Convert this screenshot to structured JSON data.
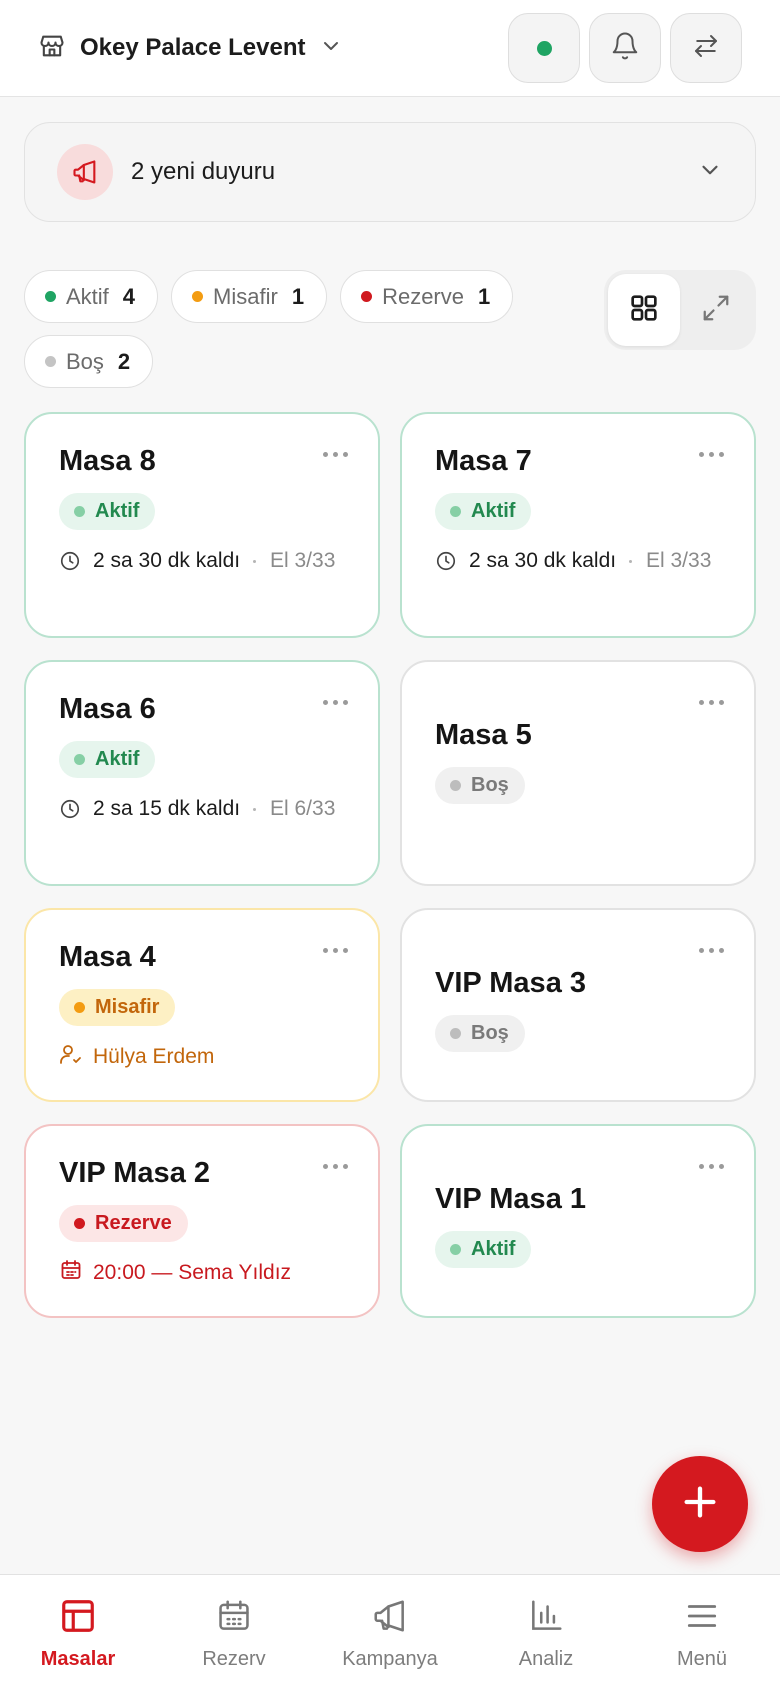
{
  "header": {
    "venue_name": "Okey Palace Levent"
  },
  "announcement": {
    "text": "2 yeni duyuru"
  },
  "filters": [
    {
      "label": "Aktif",
      "count": "4",
      "color": "#1fa463"
    },
    {
      "label": "Misafir",
      "count": "1",
      "color": "#f39c12"
    },
    {
      "label": "Rezerve",
      "count": "1",
      "color": "#d0191f"
    },
    {
      "label": "Boş",
      "count": "2",
      "color": "#c4c4c4"
    }
  ],
  "tables": [
    {
      "name": "Masa 8",
      "status": "Aktif",
      "time_left": "2 sa 30 dk kaldı",
      "hand": "El 3/33"
    },
    {
      "name": "Masa 7",
      "status": "Aktif",
      "time_left": "2 sa 30 dk kaldı",
      "hand": "El 3/33"
    },
    {
      "name": "Masa 6",
      "status": "Aktif",
      "time_left": "2 sa 15 dk kaldı",
      "hand": "El 6/33"
    },
    {
      "name": "Masa 5",
      "status": "Boş"
    },
    {
      "name": "Masa 4",
      "status": "Misafir",
      "guest": "Hülya Erdem"
    },
    {
      "name": "VIP Masa 3",
      "status": "Boş"
    },
    {
      "name": "VIP Masa 2",
      "status": "Rezerve",
      "reservation": "20:00 — Sema Yıldız"
    },
    {
      "name": "VIP Masa 1",
      "status": "Aktif"
    }
  ],
  "bottom_nav": [
    {
      "label": "Masalar",
      "icon": "table-icon",
      "active": true
    },
    {
      "label": "Rezerv",
      "icon": "calendar-icon",
      "active": false
    },
    {
      "label": "Kampanya",
      "icon": "megaphone-icon",
      "active": false
    },
    {
      "label": "Analiz",
      "icon": "bar-chart-icon",
      "active": false
    },
    {
      "label": "Menü",
      "icon": "hamburger-icon",
      "active": false
    }
  ],
  "colors": {
    "brand_red": "#d4191f",
    "aktif_green": "#1fa463",
    "misafir_orange": "#f39c12"
  }
}
